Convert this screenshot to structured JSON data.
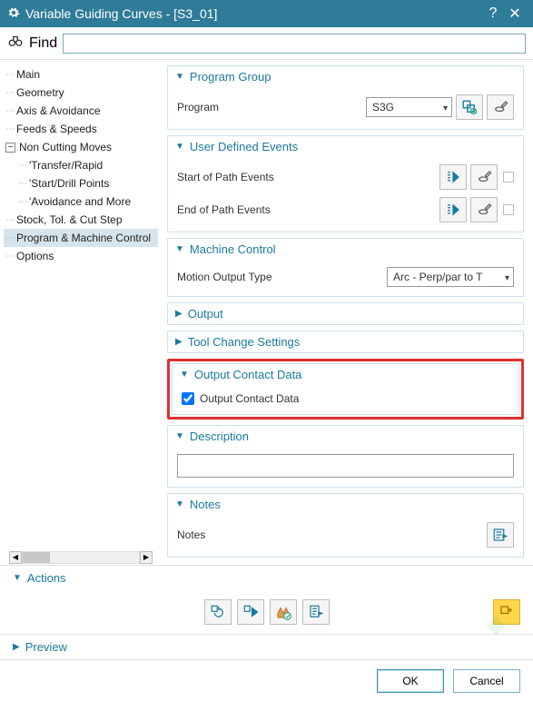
{
  "window": {
    "title": "Variable Guiding Curves - [S3_01]"
  },
  "find": {
    "label": "Find",
    "value": ""
  },
  "tree": {
    "items": [
      {
        "label": "Main"
      },
      {
        "label": "Geometry"
      },
      {
        "label": "Axis & Avoidance"
      },
      {
        "label": "Feeds & Speeds"
      },
      {
        "label": "Non Cutting Moves",
        "expanded": true,
        "children": [
          {
            "label": "'Transfer/Rapid"
          },
          {
            "label": "'Start/Drill Points"
          },
          {
            "label": "'Avoidance and More"
          }
        ]
      },
      {
        "label": "Stock, Tol. & Cut Step"
      },
      {
        "label": "Program & Machine Control",
        "selected": true
      },
      {
        "label": "Options"
      }
    ]
  },
  "sections": {
    "program_group": {
      "title": "Program Group",
      "program_label": "Program",
      "program_value": "S3G"
    },
    "user_events": {
      "title": "User Defined Events",
      "start_label": "Start of Path Events",
      "end_label": "End of Path Events"
    },
    "machine_control": {
      "title": "Machine Control",
      "motion_label": "Motion Output Type",
      "motion_value": "Arc - Perp/par to T"
    },
    "output": {
      "title": "Output"
    },
    "tool_change": {
      "title": "Tool Change Settings"
    },
    "output_contact": {
      "title": "Output Contact Data",
      "chk_label": "Output Contact Data",
      "chk": true
    },
    "description": {
      "title": "Description",
      "value": ""
    },
    "notes": {
      "title": "Notes",
      "label": "Notes"
    }
  },
  "actions": {
    "title": "Actions"
  },
  "preview": {
    "title": "Preview"
  },
  "footer": {
    "ok": "OK",
    "cancel": "Cancel"
  }
}
